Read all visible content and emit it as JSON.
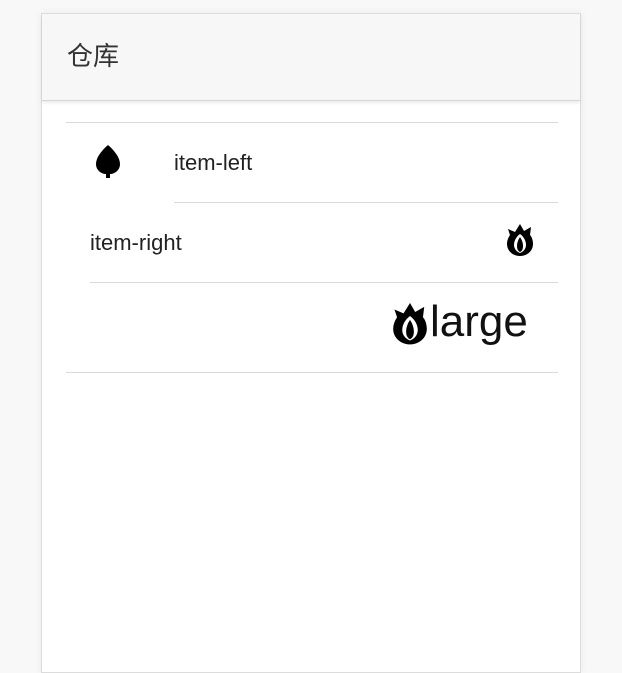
{
  "header": {
    "title": "仓库"
  },
  "list": {
    "items": [
      {
        "label": "item-left",
        "icon": "leaf-icon"
      },
      {
        "label": "item-right",
        "icon": "tulip-icon"
      },
      {
        "label": "large",
        "icon": "tulip-icon"
      }
    ]
  }
}
